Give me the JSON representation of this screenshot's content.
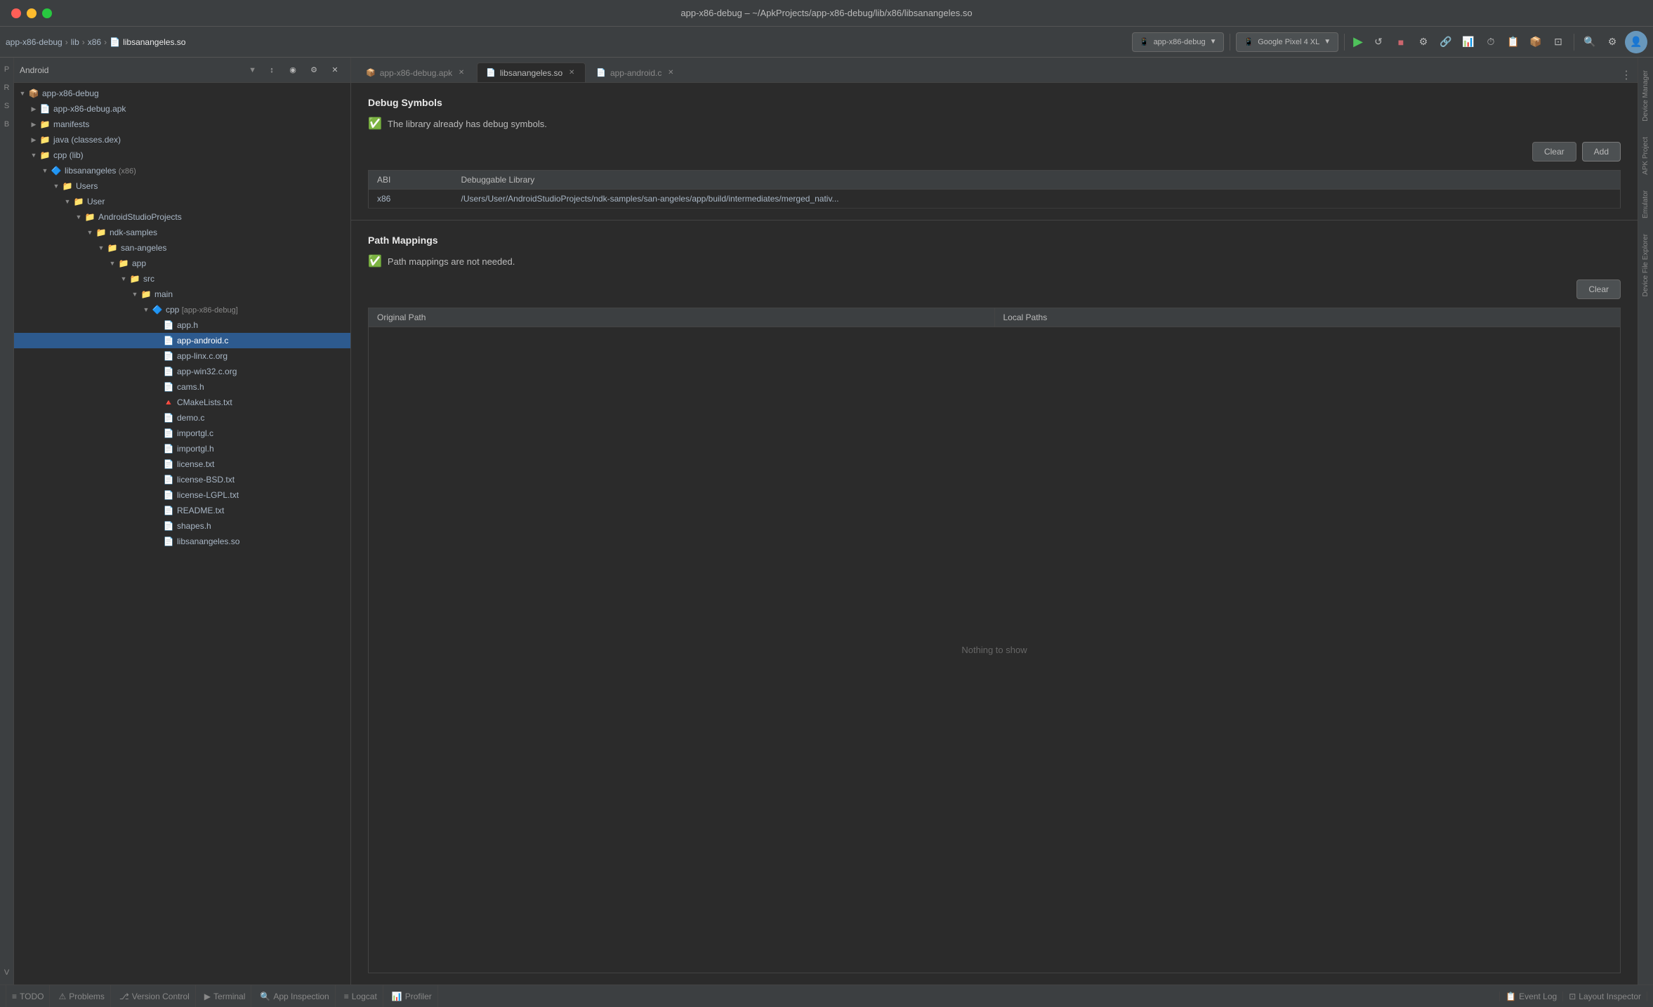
{
  "window": {
    "title": "app-x86-debug – ~/ApkProjects/app-x86-debug/lib/x86/libsanangeles.so"
  },
  "breadcrumb": {
    "items": [
      "app-x86-debug",
      "lib",
      "x86",
      "libsanangeles.so"
    ]
  },
  "toolbar": {
    "device_selector": "app-x86-debug",
    "device_model": "Google Pixel 4 XL"
  },
  "tabs": [
    {
      "label": "app-x86-debug.apk",
      "active": false,
      "closeable": true
    },
    {
      "label": "libsanangeles.so",
      "active": true,
      "closeable": true
    },
    {
      "label": "app-android.c",
      "active": false,
      "closeable": true
    }
  ],
  "panel": {
    "title": "Android",
    "root": "app-x86-debug",
    "tree": [
      {
        "indent": 0,
        "expanded": true,
        "label": "app-x86-debug",
        "type": "module",
        "icon": "📦"
      },
      {
        "indent": 1,
        "expanded": false,
        "label": "app-x86-debug.apk",
        "type": "apk",
        "icon": "📄"
      },
      {
        "indent": 1,
        "expanded": false,
        "label": "manifests",
        "type": "folder",
        "icon": "📁"
      },
      {
        "indent": 1,
        "expanded": false,
        "label": "java (classes.dex)",
        "type": "folder",
        "icon": "📁"
      },
      {
        "indent": 1,
        "expanded": true,
        "label": "cpp (lib)",
        "type": "folder",
        "icon": "📁"
      },
      {
        "indent": 2,
        "expanded": true,
        "label": "libsanangeles (x86)",
        "type": "cpp",
        "icon": "🔷",
        "tag": "(x86)"
      },
      {
        "indent": 3,
        "expanded": true,
        "label": "Users",
        "type": "folder",
        "icon": "📁"
      },
      {
        "indent": 4,
        "expanded": true,
        "label": "User",
        "type": "folder",
        "icon": "📁"
      },
      {
        "indent": 5,
        "expanded": true,
        "label": "AndroidStudioProjects",
        "type": "folder",
        "icon": "📁"
      },
      {
        "indent": 6,
        "expanded": true,
        "label": "ndk-samples",
        "type": "folder",
        "icon": "📁"
      },
      {
        "indent": 7,
        "expanded": true,
        "label": "san-angeles",
        "type": "folder",
        "icon": "📁"
      },
      {
        "indent": 8,
        "expanded": true,
        "label": "app",
        "type": "folder",
        "icon": "📁"
      },
      {
        "indent": 9,
        "expanded": true,
        "label": "src",
        "type": "folder",
        "icon": "📁"
      },
      {
        "indent": 10,
        "expanded": true,
        "label": "main",
        "type": "folder",
        "icon": "📁"
      },
      {
        "indent": 11,
        "expanded": true,
        "label": "cpp [app-x86-debug]",
        "type": "cpp_module",
        "icon": "🔷"
      },
      {
        "indent": 12,
        "label": "app.h",
        "type": "cpp_file",
        "icon": "📄"
      },
      {
        "indent": 12,
        "label": "app-android.c",
        "type": "cpp_file",
        "icon": "📄",
        "selected": true
      },
      {
        "indent": 12,
        "label": "app-linx.c.org",
        "type": "cpp_file",
        "icon": "📄"
      },
      {
        "indent": 12,
        "label": "app-win32.c.org",
        "type": "cpp_file",
        "icon": "📄"
      },
      {
        "indent": 12,
        "label": "cams.h",
        "type": "cpp_file",
        "icon": "📄"
      },
      {
        "indent": 12,
        "label": "CMakeLists.txt",
        "type": "cmake",
        "icon": "🔺"
      },
      {
        "indent": 12,
        "label": "demo.c",
        "type": "cpp_file",
        "icon": "📄"
      },
      {
        "indent": 12,
        "label": "importgl.c",
        "type": "cpp_file",
        "icon": "📄"
      },
      {
        "indent": 12,
        "label": "importgl.h",
        "type": "cpp_file",
        "icon": "📄"
      },
      {
        "indent": 12,
        "label": "license.txt",
        "type": "text_file",
        "icon": "📄"
      },
      {
        "indent": 12,
        "label": "license-BSD.txt",
        "type": "text_file",
        "icon": "📄"
      },
      {
        "indent": 12,
        "label": "license-LGPL.txt",
        "type": "text_file",
        "icon": "📄"
      },
      {
        "indent": 12,
        "label": "README.txt",
        "type": "text_file",
        "icon": "📄"
      },
      {
        "indent": 12,
        "label": "shapes.h",
        "type": "cpp_file",
        "icon": "📄"
      },
      {
        "indent": 12,
        "label": "libsanangeles.so",
        "type": "so_file",
        "icon": "📄"
      }
    ]
  },
  "debug_symbols": {
    "section_title": "Debug Symbols",
    "status_message": "The library already has debug symbols.",
    "clear_btn": "Clear",
    "add_btn": "Add",
    "table": {
      "headers": [
        "ABI",
        "Debuggable Library"
      ],
      "rows": [
        {
          "abi": "x86",
          "library": "/Users/User/AndroidStudioProjects/ndk-samples/san-angeles/app/build/intermediates/merged_nativ..."
        }
      ]
    }
  },
  "path_mappings": {
    "section_title": "Path Mappings",
    "status_message": "Path mappings are not needed.",
    "clear_btn": "Clear",
    "table": {
      "headers": [
        "Original Path",
        "Local Paths"
      ],
      "empty_message": "Nothing to show"
    }
  },
  "status_bar": {
    "items": [
      {
        "icon": "≡",
        "label": "TODO"
      },
      {
        "icon": "⚠",
        "label": "Problems"
      },
      {
        "icon": "⎇",
        "label": "Version Control"
      },
      {
        "icon": "▶",
        "label": "Terminal"
      },
      {
        "icon": "🔍",
        "label": "App Inspection"
      },
      {
        "icon": "≡",
        "label": "Logcat"
      },
      {
        "icon": "📊",
        "label": "Profiler"
      }
    ],
    "right_items": [
      {
        "icon": "📋",
        "label": "Event Log"
      },
      {
        "icon": "⊡",
        "label": "Layout Inspector"
      }
    ]
  },
  "right_strip": {
    "tabs": [
      "Device Manager",
      "APK Project",
      "Emulator",
      "Device File Explorer"
    ]
  },
  "left_strip": {
    "tabs": [
      "Project",
      "Resource Manager",
      "Structure",
      "Bookmarks",
      "Build Variants"
    ]
  }
}
